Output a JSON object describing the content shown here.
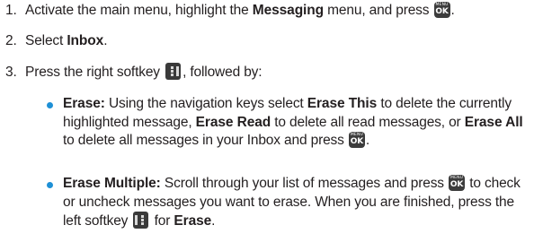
{
  "steps": [
    {
      "number": "1.",
      "text1": "Activate the main menu, highlight the ",
      "bold1": "Messaging",
      "text2": " menu, and press ",
      "text3": "."
    },
    {
      "number": "2.",
      "text1": "Select ",
      "bold1": "Inbox",
      "text2": "."
    },
    {
      "number": "3.",
      "text1": "Press the right softkey ",
      "text2": ", followed by:"
    }
  ],
  "bullets": [
    {
      "title": "Erase:",
      "t1": " Using the navigation keys select ",
      "b1": "Erase This",
      "t2": " to delete the currently highlighted message, ",
      "b2": "Erase Read",
      "t3": " to delete all read messages, or ",
      "b3": "Erase All",
      "t4": " to delete all messages in your Inbox and press ",
      "t5": "."
    },
    {
      "title": "Erase Multiple:",
      "t1": " Scroll through your list of messages and press ",
      "t2": " to check or uncheck messages you want to erase. When you are finished, press the left softkey ",
      "t3": " for ",
      "b1": "Erase",
      "t4": "."
    }
  ],
  "keys": {
    "menu_ok_top": "MENU",
    "menu_ok_bottom": "OK"
  },
  "colors": {
    "bullet": "#1e90d6",
    "text": "#231f20"
  },
  "icons": [
    "menu-ok-key-icon",
    "right-softkey-icon",
    "left-softkey-icon"
  ]
}
